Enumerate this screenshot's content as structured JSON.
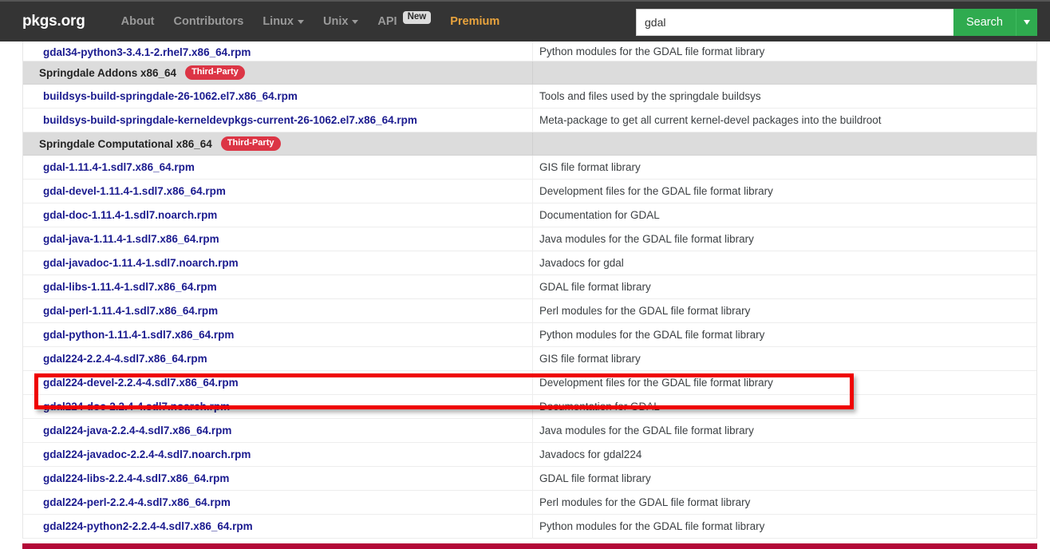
{
  "brand": "pkgs.org",
  "nav": {
    "items": [
      {
        "label": "About",
        "caret": false,
        "badge": null,
        "premium": false
      },
      {
        "label": "Contributors",
        "caret": false,
        "badge": null,
        "premium": false
      },
      {
        "label": "Linux",
        "caret": true,
        "badge": null,
        "premium": false
      },
      {
        "label": "Unix",
        "caret": true,
        "badge": null,
        "premium": false
      },
      {
        "label": "API",
        "caret": false,
        "badge": "New",
        "premium": false
      },
      {
        "label": "Premium",
        "caret": false,
        "badge": null,
        "premium": true
      }
    ]
  },
  "search": {
    "value": "gdal",
    "placeholder": "",
    "button_label": "Search",
    "button_color": "#2fab4f",
    "dropdown_icon": "caret-down-icon"
  },
  "colors": {
    "navbar_bg": "#343434",
    "link_blue": "#1b1b8f",
    "group_header_bg": "#dcdcdc",
    "badge_third_party": "#dc3545",
    "badge_new": "#dcdcdc",
    "premium_gold": "#e8a33d",
    "bottom_bar": "#b30837",
    "annotation_red": "#ef0000"
  },
  "annotation": {
    "type": "rectangle-highlight",
    "color": "#ef0000",
    "target_row": "gdal224-devel-2.2.4-4.sdl7.x86_64.rpm"
  },
  "rows": [
    {
      "kind": "package",
      "name": "gdal34-python3-3.4.1-2.rhel7.x86_64.rpm",
      "desc": "Python modules for the GDAL file format library",
      "clipped_top": true
    },
    {
      "kind": "group",
      "title": "Springdale Addons x86_64",
      "badge": "Third-Party"
    },
    {
      "kind": "package",
      "name": "buildsys-build-springdale-26-1062.el7.x86_64.rpm",
      "desc": "Tools and files used by the springdale buildsys"
    },
    {
      "kind": "package",
      "name": "buildsys-build-springdale-kerneldevpkgs-current-26-1062.el7.x86_64.rpm",
      "desc": "Meta-package to get all current kernel-devel packages into the buildroot"
    },
    {
      "kind": "group",
      "title": "Springdale Computational x86_64",
      "badge": "Third-Party"
    },
    {
      "kind": "package",
      "name": "gdal-1.11.4-1.sdl7.x86_64.rpm",
      "desc": "GIS file format library"
    },
    {
      "kind": "package",
      "name": "gdal-devel-1.11.4-1.sdl7.x86_64.rpm",
      "desc": "Development files for the GDAL file format library"
    },
    {
      "kind": "package",
      "name": "gdal-doc-1.11.4-1.sdl7.noarch.rpm",
      "desc": "Documentation for GDAL"
    },
    {
      "kind": "package",
      "name": "gdal-java-1.11.4-1.sdl7.x86_64.rpm",
      "desc": "Java modules for the GDAL file format library"
    },
    {
      "kind": "package",
      "name": "gdal-javadoc-1.11.4-1.sdl7.noarch.rpm",
      "desc": "Javadocs for gdal"
    },
    {
      "kind": "package",
      "name": "gdal-libs-1.11.4-1.sdl7.x86_64.rpm",
      "desc": "GDAL file format library"
    },
    {
      "kind": "package",
      "name": "gdal-perl-1.11.4-1.sdl7.x86_64.rpm",
      "desc": "Perl modules for the GDAL file format library"
    },
    {
      "kind": "package",
      "name": "gdal-python-1.11.4-1.sdl7.x86_64.rpm",
      "desc": "Python modules for the GDAL file format library"
    },
    {
      "kind": "package",
      "name": "gdal224-2.2.4-4.sdl7.x86_64.rpm",
      "desc": "GIS file format library"
    },
    {
      "kind": "package",
      "name": "gdal224-devel-2.2.4-4.sdl7.x86_64.rpm",
      "desc": "Development files for the GDAL file format library",
      "highlighted": true
    },
    {
      "kind": "package",
      "name": "gdal224-doc-2.2.4-4.sdl7.noarch.rpm",
      "desc": "Documentation for GDAL"
    },
    {
      "kind": "package",
      "name": "gdal224-java-2.2.4-4.sdl7.x86_64.rpm",
      "desc": "Java modules for the GDAL file format library"
    },
    {
      "kind": "package",
      "name": "gdal224-javadoc-2.2.4-4.sdl7.noarch.rpm",
      "desc": "Javadocs for gdal224"
    },
    {
      "kind": "package",
      "name": "gdal224-libs-2.2.4-4.sdl7.x86_64.rpm",
      "desc": "GDAL file format library"
    },
    {
      "kind": "package",
      "name": "gdal224-perl-2.2.4-4.sdl7.x86_64.rpm",
      "desc": "Perl modules for the GDAL file format library"
    },
    {
      "kind": "package",
      "name": "gdal224-python2-2.2.4-4.sdl7.x86_64.rpm",
      "desc": "Python modules for the GDAL file format library"
    }
  ]
}
